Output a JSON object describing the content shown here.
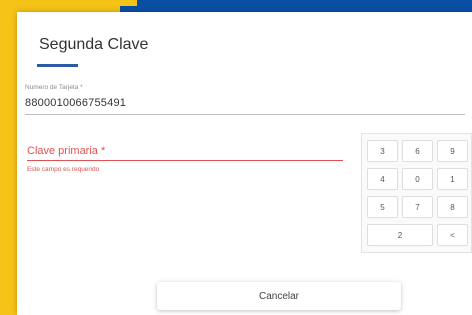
{
  "dialog": {
    "title": "Segunda Clave"
  },
  "card_field": {
    "label": "Numero de Tarjeta *",
    "value": "8800010066755491"
  },
  "password_field": {
    "label": "Clave primaria *",
    "error": "Este campo es requerido"
  },
  "keypad": {
    "keys": [
      "3",
      "6",
      "9",
      "4",
      "0",
      "1",
      "5",
      "7",
      "8",
      "2",
      "<"
    ]
  },
  "actions": {
    "cancel_label": "Cancelar"
  },
  "colors": {
    "brand_blue": "#0a4fa6",
    "brand_yellow": "#f6c418",
    "accent_blue": "#2c5aa6",
    "error_red": "#e05252"
  }
}
